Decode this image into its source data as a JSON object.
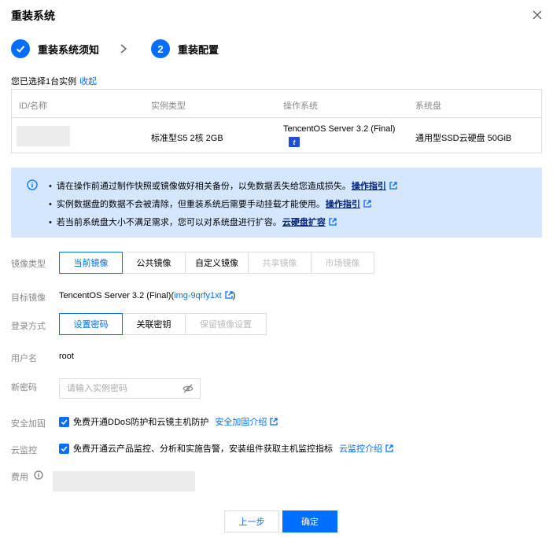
{
  "dialog": {
    "title": "重装系统"
  },
  "steps": [
    {
      "label": "重装系统须知",
      "state": "done"
    },
    {
      "number": "2",
      "label": "重装配置",
      "state": "active"
    }
  ],
  "selection": {
    "text": "您已选择1台实例",
    "collapse_link": "收起"
  },
  "instance_table": {
    "headers": [
      "ID/名称",
      "实例类型",
      "操作系统",
      "系统盘"
    ],
    "row": {
      "id": "",
      "type": "标准型S5 2核 2GB",
      "os": "TencentOS Server 3.2 (Final)",
      "os_badge": "t",
      "disk": "通用型SSD云硬盘 50GiB"
    }
  },
  "notice": {
    "lines": [
      {
        "text": "请在操作前通过制作快照或镜像做好相关备份，以免数据丢失给您造成损失。",
        "link": "操作指引"
      },
      {
        "text": "实例数据盘的数据不会被清除，但重装系统后需要手动挂载才能使用。",
        "link": "操作指引"
      },
      {
        "text": "若当前系统盘大小不满足需求，您可以对系统盘进行扩容。",
        "link": "云硬盘扩容"
      }
    ]
  },
  "form": {
    "image_type": {
      "label": "镜像类型",
      "options": [
        "当前镜像",
        "公共镜像",
        "自定义镜像",
        "共享镜像",
        "市场镜像"
      ],
      "selected": "当前镜像"
    },
    "target_image": {
      "label": "目标镜像",
      "value": "TencentOS Server 3.2 (Final)(",
      "image_id": "img-9qrfy1xt",
      "suffix": ")"
    },
    "login_method": {
      "label": "登录方式",
      "options": [
        "设置密码",
        "关联密钥",
        "保留镜像设置"
      ],
      "selected": "设置密码"
    },
    "username": {
      "label": "用户名",
      "value": "root"
    },
    "new_password": {
      "label": "新密码",
      "placeholder": "请输入实例密码",
      "value": ""
    },
    "security": {
      "label": "安全加固",
      "checkbox_text": "免费开通DDoS防护和云镜主机防护",
      "link": "安全加固介绍",
      "checked": true
    },
    "monitoring": {
      "label": "云监控",
      "checkbox_text": "免费开通云产品监控、分析和实施告警，安装组件获取主机监控指标",
      "link": "云监控介绍",
      "checked": true
    },
    "fee": {
      "label": "费用"
    }
  },
  "footer": {
    "prev_label": "上一步",
    "ok_label": "确定"
  },
  "colors": {
    "accent": "#006eff",
    "notice_bg": "#d5e7ff",
    "notice_link": "#00227a"
  }
}
